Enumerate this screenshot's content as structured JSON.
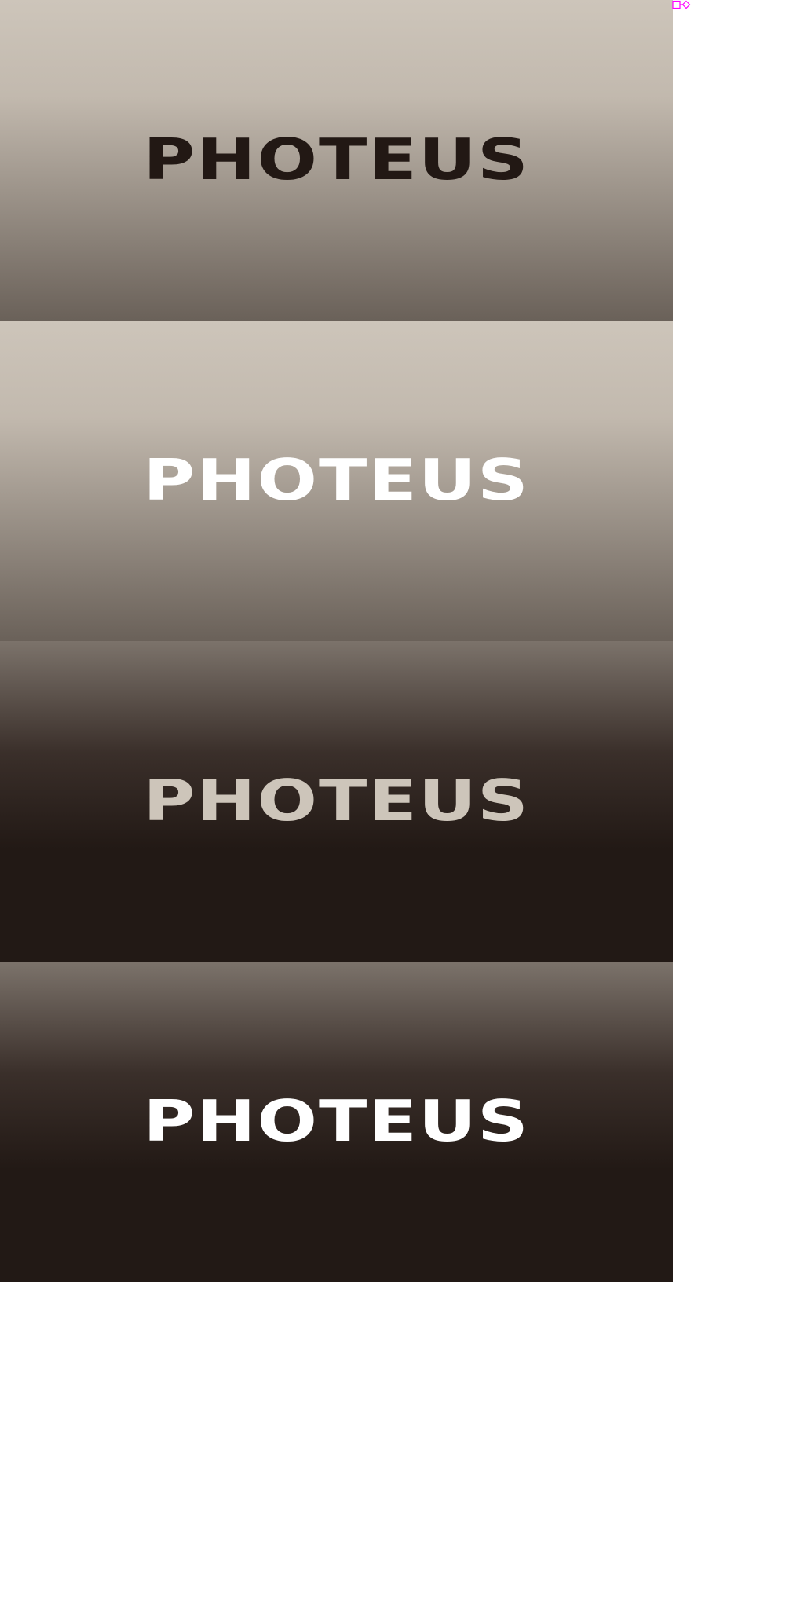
{
  "panels": [
    {
      "id": "light-dark-text",
      "text": "PHOTEUS",
      "gradient_top": "#cdc5ba",
      "gradient_mid": "#c2b9ae",
      "gradient_bottom": "#6a6159",
      "text_color": "#221814"
    },
    {
      "id": "light-white-text",
      "text": "PHOTEUS",
      "gradient_top": "#cdc5ba",
      "gradient_mid": "#c2b9ae",
      "gradient_bottom": "#6a6159",
      "text_color": "#ffffff"
    },
    {
      "id": "dark-beige-text",
      "text": "PHOTEUS",
      "gradient_top": "#7c736b",
      "gradient_mid": "#3a2f2a",
      "gradient_bottom": "#221915",
      "text_color": "#cdc5ba"
    },
    {
      "id": "dark-white-text",
      "text": "PHOTEUS",
      "gradient_top": "#7c736b",
      "gradient_mid": "#3a2f2a",
      "gradient_bottom": "#221915",
      "text_color": "#ffffff"
    }
  ],
  "marker": {
    "icon": "selection-handle-icon",
    "color": "#ff00ff"
  }
}
